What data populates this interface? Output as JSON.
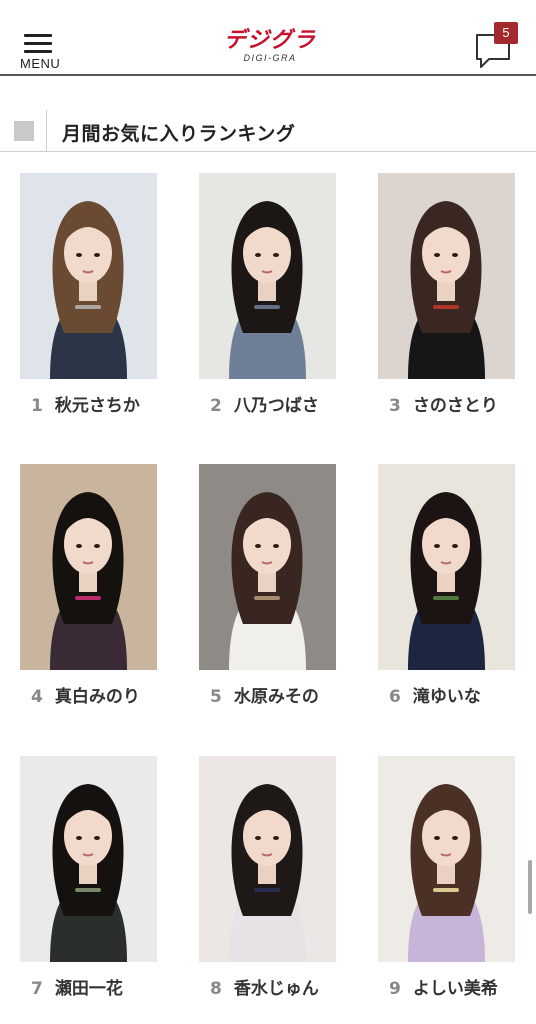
{
  "header": {
    "menu_label": "MENU",
    "logo_text": "デジグラ",
    "logo_subtext": "DIGI-GRA",
    "notification_count": "5"
  },
  "section": {
    "title": "月間お気に入りランキング"
  },
  "ranking": [
    {
      "rank": "1",
      "name": "秋元さちか",
      "bg": "#dfe4ea",
      "hair": "#6b4a32",
      "top": "#2c3547",
      "accent": "#b7b7b7"
    },
    {
      "rank": "2",
      "name": "八乃つばさ",
      "bg": "#e6e6e3",
      "hair": "#1c1714",
      "top": "#6f7f98",
      "accent": "#6f7f98"
    },
    {
      "rank": "3",
      "name": "さのさとり",
      "bg": "#dcd5cf",
      "hair": "#3a2722",
      "top": "#161616",
      "accent": "#c43a2a"
    },
    {
      "rank": "4",
      "name": "真白みのり",
      "bg": "#c9b59e",
      "hair": "#15110f",
      "top": "#3a2a35",
      "accent": "#d6327e"
    },
    {
      "rank": "5",
      "name": "水原みその",
      "bg": "#8e8a86",
      "hair": "#3a2621",
      "top": "#f1efec",
      "accent": "#bba07a"
    },
    {
      "rank": "6",
      "name": "滝ゆいな",
      "bg": "#e9e5dc",
      "hair": "#1b1412",
      "top": "#1d2540",
      "accent": "#5a8a46"
    },
    {
      "rank": "7",
      "name": "瀬田一花",
      "bg": "#eaeaea",
      "hair": "#14110f",
      "top": "#2b2f2b",
      "accent": "#8a9b7a"
    },
    {
      "rank": "8",
      "name": "香水じゅん",
      "bg": "#ece7e4",
      "hair": "#1e1816",
      "top": "#e8e2e7",
      "accent": "#2a2f5a"
    },
    {
      "rank": "9",
      "name": "よしい美希",
      "bg": "#eeebe6",
      "hair": "#4a3025",
      "top": "#c7b4d9",
      "accent": "#f3e4a2"
    }
  ],
  "colors": {
    "brand": "#c8102e",
    "badge": "#a5282f",
    "rank_number": "#888888"
  }
}
